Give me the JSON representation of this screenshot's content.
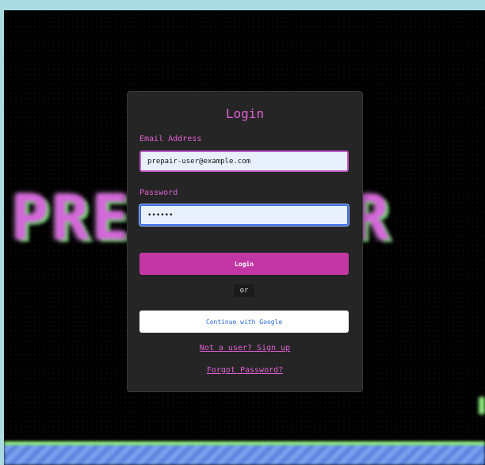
{
  "background": {
    "title_left": "PRE",
    "title_right": "AIR",
    "title_color": "#e06ee6",
    "accent_green": "#8be77c",
    "strip_blue": "#6a90e6"
  },
  "login_form": {
    "title": "Login",
    "email": {
      "label": "Email Address",
      "value": "prepair-user@example.com"
    },
    "password": {
      "label": "Password",
      "value": "••••••"
    },
    "login_button_label": "Login",
    "divider_text": "or",
    "google_button_label": "Continue with Google",
    "signup_link": "Not a user? Sign up",
    "forgot_link": "Forgot Password?",
    "accent_color": "#e060d2",
    "button_color": "#c237a4"
  }
}
